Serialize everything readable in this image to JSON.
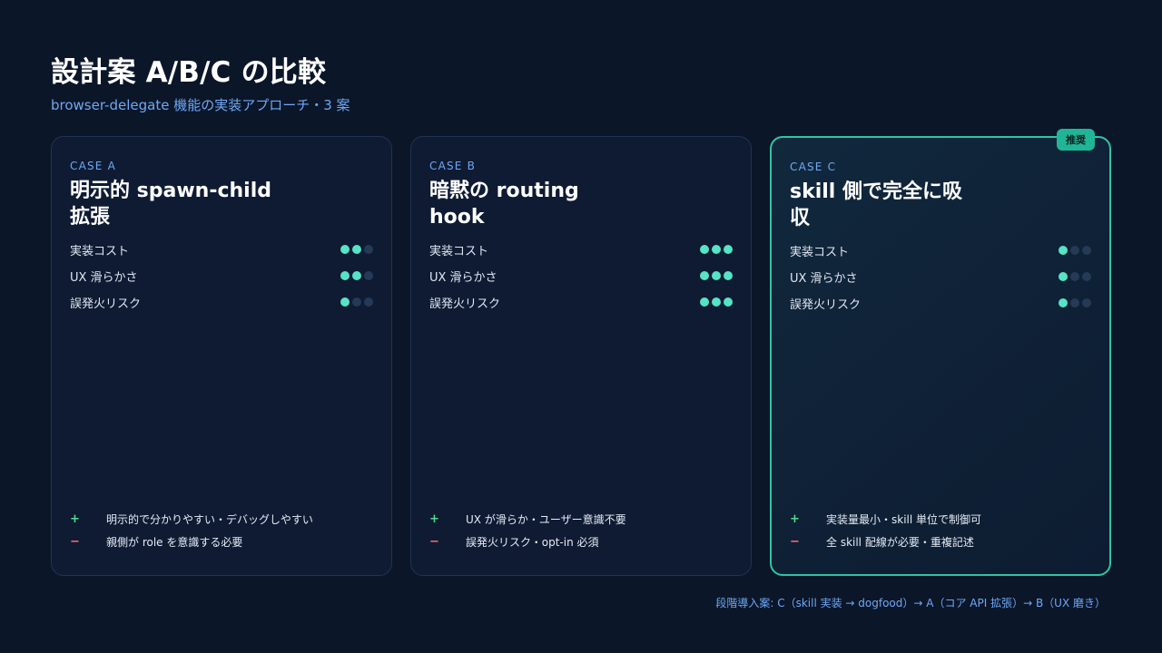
{
  "title": "設計案 A/B/C の比較",
  "subtitle": "browser-delegate 機能の実装アプローチ・3 案",
  "metric_labels": [
    "実装コスト",
    "UX 滑らかさ",
    "誤発火リスク"
  ],
  "colors": {
    "accent": "#2fc4a3",
    "dot_on": "#56e3c6",
    "dot_off": "#253a56",
    "pro": "#4fdc8e",
    "con": "#ff6b6b",
    "subtitle": "#6ea8f5"
  },
  "cases": [
    {
      "tag": "CASE A",
      "title": "明示的 spawn-child 拡張",
      "scores": [
        2,
        2,
        1
      ],
      "pro": "明示的で分かりやすい・デバッグしやすい",
      "con": "親側が role を意識する必要"
    },
    {
      "tag": "CASE B",
      "title": "暗黙の routing hook",
      "scores": [
        3,
        3,
        3
      ],
      "pro": "UX が滑らか・ユーザー意識不要",
      "con": "誤発火リスク・opt-in 必須"
    },
    {
      "tag": "CASE C",
      "title": "skill 側で完全に吸収",
      "badge": "推奨",
      "scores": [
        1,
        1,
        1
      ],
      "pro": "実装量最小・skill 単位で制御可",
      "con": "全 skill 配線が必要・重複記述"
    }
  ],
  "signs": {
    "pro": "+",
    "con": "−"
  },
  "footer": "段階導入案: C（skill 実装 → dogfood）→ A（コア API 拡張）→ B（UX 磨き）"
}
